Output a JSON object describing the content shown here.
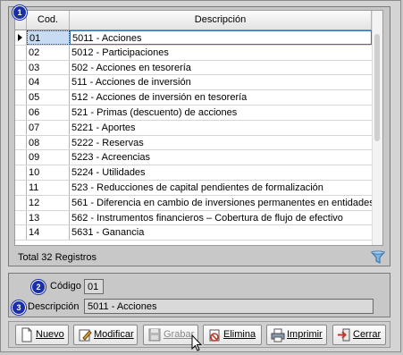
{
  "grid": {
    "badge": "1",
    "columns": {
      "cod": "Cod.",
      "descripcion": "Descripción"
    },
    "rows": [
      {
        "cod": "01",
        "desc": "5011 - Acciones"
      },
      {
        "cod": "02",
        "desc": "5012 - Participaciones"
      },
      {
        "cod": "03",
        "desc": "502 - Acciones en tesorería"
      },
      {
        "cod": "04",
        "desc": "511 - Acciones de inversión"
      },
      {
        "cod": "05",
        "desc": "512 - Acciones de inversión en tesorería"
      },
      {
        "cod": "06",
        "desc": "521 - Primas (descuento) de acciones"
      },
      {
        "cod": "07",
        "desc": "5221 - Aportes"
      },
      {
        "cod": "08",
        "desc": "5222 - Reservas"
      },
      {
        "cod": "09",
        "desc": "5223 - Acreencias"
      },
      {
        "cod": "10",
        "desc": "5224 - Utilidades"
      },
      {
        "cod": "11",
        "desc": "523 - Reducciones de capital pendientes de formalización"
      },
      {
        "cod": "12",
        "desc": "561 - Diferencia en cambio de inversiones permanentes en entidades"
      },
      {
        "cod": "13",
        "desc": "562 - Instrumentos financieros – Cobertura de flujo de efectivo"
      },
      {
        "cod": "14",
        "desc": "5631 - Ganancia"
      }
    ],
    "total_text": "Total 32 Registros"
  },
  "form": {
    "codigo_badge": "2",
    "codigo_label": "Código",
    "codigo_value": "01",
    "descripcion_badge": "3",
    "descripcion_label": "Descripción",
    "descripcion_value": "5011 - Acciones"
  },
  "toolbar": {
    "nuevo": "Nuevo",
    "modificar": "Modificar",
    "grabar": "Grabar",
    "elimina": "Elimina",
    "imprimir": "Imprimir",
    "cerrar": "Cerrar"
  },
  "colors": {
    "badge": "#1b2fa8",
    "selection": "#c7dcf2"
  },
  "icons": [
    "filter-icon",
    "new-document-icon",
    "edit-icon",
    "save-icon",
    "delete-icon",
    "printer-icon",
    "exit-icon",
    "mouse-cursor-icon"
  ]
}
